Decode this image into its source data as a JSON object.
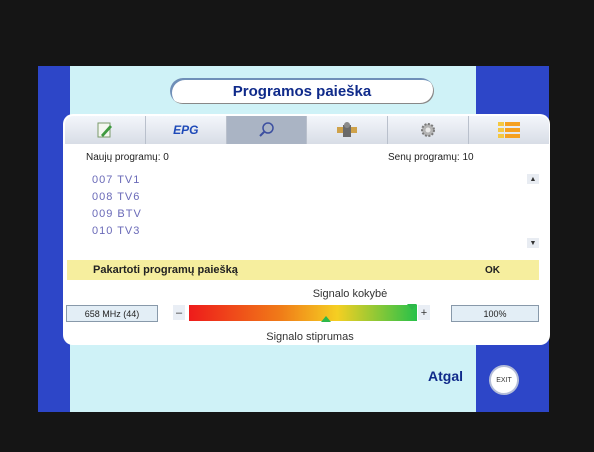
{
  "title": "Programos paieška",
  "tabs": [
    {
      "icon": "edit-icon",
      "label": ""
    },
    {
      "icon": "epg-icon",
      "label": "EPG"
    },
    {
      "icon": "search-icon",
      "label": ""
    },
    {
      "icon": "satellite-icon",
      "label": ""
    },
    {
      "icon": "gear-icon",
      "label": ""
    },
    {
      "icon": "grid-icon",
      "label": ""
    }
  ],
  "new_programs": "Naujų programų: 0",
  "old_programs": "Senų programų: 10",
  "channels": [
    "007  TV1",
    "008  TV6",
    "009  BTV",
    "010  TV3"
  ],
  "rescan": {
    "label": "Pakartoti programų paiešką",
    "ok": "OK"
  },
  "signal": {
    "quality_label": "Signalo kokybė",
    "strength_label": "Signalo stiprumas",
    "frequency": "658 MHz (44)",
    "percent": "100%",
    "quality_level": 1.0,
    "strength_level": 0.6,
    "minus": "–",
    "plus": "+"
  },
  "footer": {
    "back_label": "Atgal",
    "exit_label": "EXIT"
  },
  "colors": {
    "frame": "#2d46c8",
    "panel": "#cff2f7",
    "rescan_highlight": "#f6ee9e",
    "title_text": "#0f2a8a"
  }
}
